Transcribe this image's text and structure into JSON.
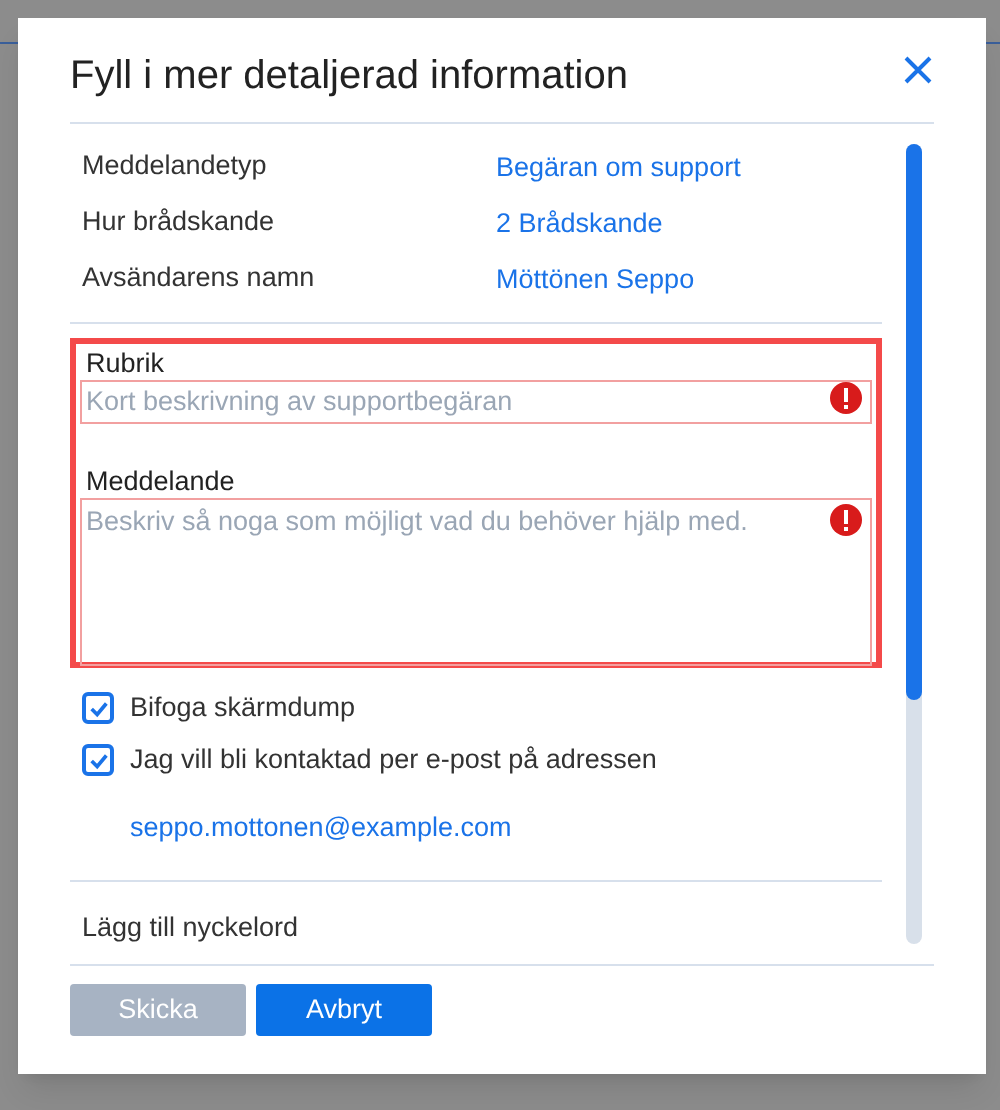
{
  "dialog": {
    "title": "Fyll i mer detaljerad information",
    "details": [
      {
        "label": "Meddelandetyp",
        "value": "Begäran om support"
      },
      {
        "label": "Hur brådskande",
        "value": "2 Brådskande"
      },
      {
        "label": "Avsändarens namn",
        "value": "Möttönen Seppo"
      }
    ],
    "required_group": {
      "highlighted": true,
      "fields": [
        {
          "kind": "input",
          "label": "Rubrik",
          "placeholder": "Kort beskrivning av supportbegäran",
          "error": true
        },
        {
          "kind": "textarea",
          "label": "Meddelande",
          "placeholder": "Beskriv så noga som möjligt vad du behöver hjälp med.",
          "error": true
        }
      ]
    },
    "checkboxes": [
      {
        "label": "Bifoga skärmdump",
        "checked": true
      },
      {
        "label": "Jag vill bli kontaktad per e-post på adressen",
        "checked": true
      }
    ],
    "email": "seppo.mottonen@example.com",
    "keywords_link": "Lägg till nyckelord",
    "buttons": [
      {
        "label": "Skicka",
        "disabled": true
      },
      {
        "label": "Avbryt",
        "disabled": false
      }
    ]
  }
}
